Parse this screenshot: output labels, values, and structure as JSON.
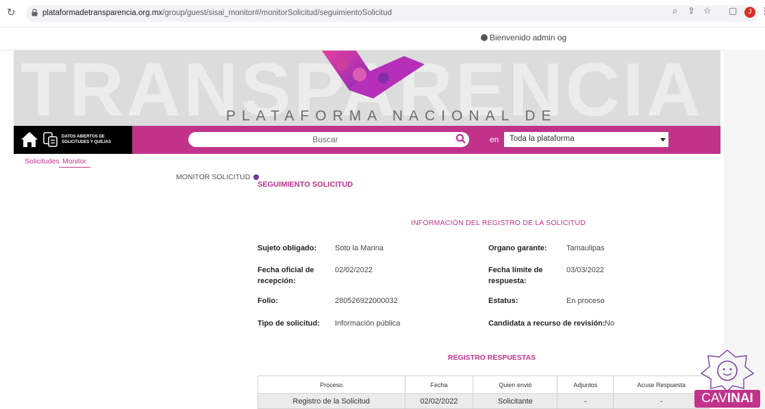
{
  "browser": {
    "url_host": "plataformadetransparencia.org.mx",
    "url_path": "/group/guest/sisai_monitor#/monitorSolicitud/seguimientoSolicitud",
    "profile_initial": "J"
  },
  "header": {
    "welcome": "Bienvenido admin og"
  },
  "banner": {
    "background_text": "TRANSPARENCIA",
    "title": "PLATAFORMA NACIONAL DE"
  },
  "navstrip": {
    "brand_line1": "DATOS ABIERTOS DE",
    "brand_line2": "SOLICITUDES Y QUEJAS",
    "search_placeholder": "Buscar",
    "en_label": "en",
    "scope_value": "Toda la plataforma"
  },
  "subnav": {
    "tabs": [
      {
        "label": "Solicitudes"
      },
      {
        "label": "Monitor"
      }
    ]
  },
  "sidebar": {
    "monitor_label": "MONITOR SOLICITUD"
  },
  "main": {
    "section_title": "SEGUIMIENTO SOLICITUD",
    "info_title": "INFORMACIÓN DEL REGISTRO DE LA SOLICITUD",
    "fields": {
      "sujeto_label": "Sujeto obligado:",
      "sujeto_value": "Soto la Marina",
      "organo_label": "Organo garante:",
      "organo_value": "Tamaulipas",
      "fecha_oficial_label": "Fecha oficial de recepción:",
      "fecha_oficial_value": "02/02/2022",
      "fecha_limite_label": "Fecha límite de respuesta:",
      "fecha_limite_value": "03/03/2022",
      "folio_label": "Folio:",
      "folio_value": "280526922000032",
      "estatus_label": "Estatus:",
      "estatus_value": "En proceso",
      "tipo_label": "Tipo de solicitud:",
      "tipo_value": "Información pública",
      "candidata_label": "Candidata a recurso de revisión:",
      "candidata_value": "No"
    },
    "registro_title": "REGISTRO RESPUESTAS",
    "table": {
      "headers": [
        "Proceso",
        "Fecha",
        "Quien envió",
        "Adjuntos",
        "Acuse Respuesta"
      ],
      "rows": [
        [
          "Registro de la Solicitud",
          "02/02/2022",
          "Solicitante",
          "-",
          "-"
        ]
      ]
    }
  },
  "chat": {
    "label_light": "CAV",
    "label_bold": "INAI"
  },
  "colors": {
    "brand_magenta": "#c1338a",
    "brand_black": "#000000",
    "banner_gray": "#dcdcdc"
  }
}
